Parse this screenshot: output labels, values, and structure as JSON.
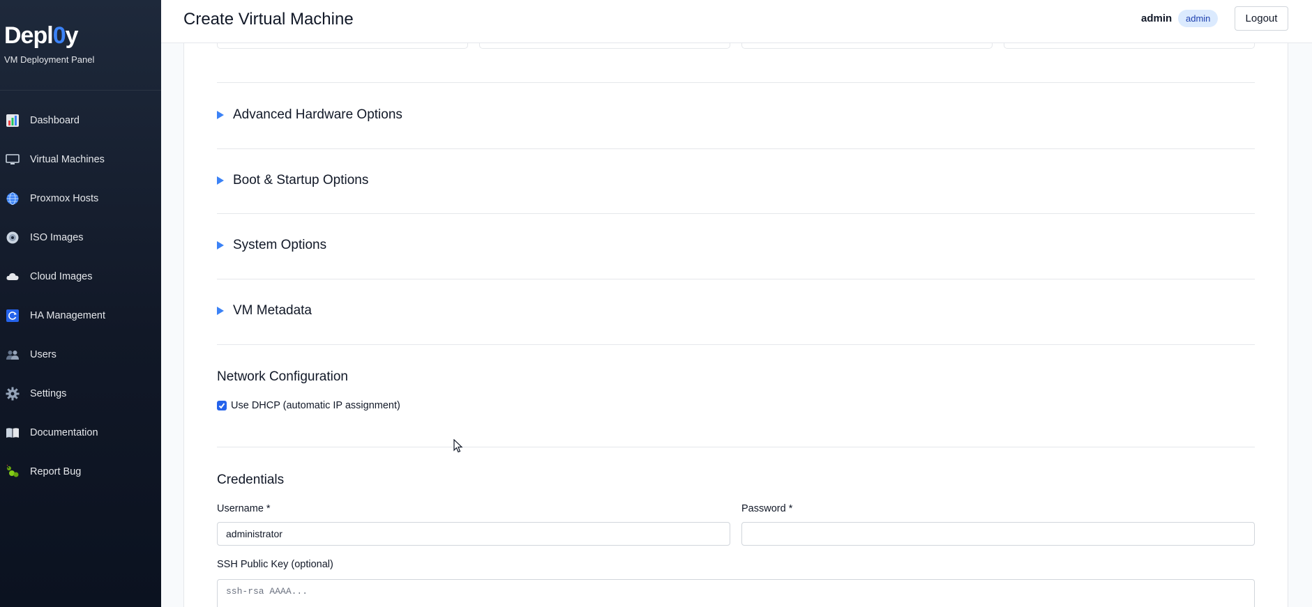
{
  "sidebar": {
    "logo_prefix": "Depl",
    "logo_zero": "0",
    "logo_suffix": "y",
    "subtitle": "VM Deployment Panel",
    "items": [
      {
        "label": "Dashboard",
        "icon": "bar-chart-icon"
      },
      {
        "label": "Virtual Machines",
        "icon": "monitor-icon"
      },
      {
        "label": "Proxmox Hosts",
        "icon": "globe-icon"
      },
      {
        "label": "ISO Images",
        "icon": "disc-icon"
      },
      {
        "label": "Cloud Images",
        "icon": "cloud-icon"
      },
      {
        "label": "HA Management",
        "icon": "refresh-icon"
      },
      {
        "label": "Users",
        "icon": "users-icon"
      },
      {
        "label": "Settings",
        "icon": "gear-icon"
      },
      {
        "label": "Documentation",
        "icon": "book-icon"
      },
      {
        "label": "Report Bug",
        "icon": "bug-icon"
      }
    ]
  },
  "header": {
    "title": "Create Virtual Machine",
    "username": "admin",
    "role": "admin",
    "logout_label": "Logout"
  },
  "sections": {
    "advanced_hardware": "Advanced Hardware Options",
    "boot_startup": "Boot & Startup Options",
    "system_options": "System Options",
    "vm_metadata": "VM Metadata"
  },
  "network": {
    "heading": "Network Configuration",
    "dhcp_label": "Use DHCP (automatic IP assignment)",
    "dhcp_checked": true
  },
  "credentials": {
    "heading": "Credentials",
    "username_label": "Username *",
    "username_value": "administrator",
    "password_label": "Password *",
    "password_value": "",
    "ssh_label": "SSH Public Key (optional)",
    "ssh_placeholder": "ssh-rsa AAAA..."
  },
  "colors": {
    "accent": "#3b82f6",
    "sidebar_bg": "#111827",
    "badge_bg": "#dbeafe"
  }
}
